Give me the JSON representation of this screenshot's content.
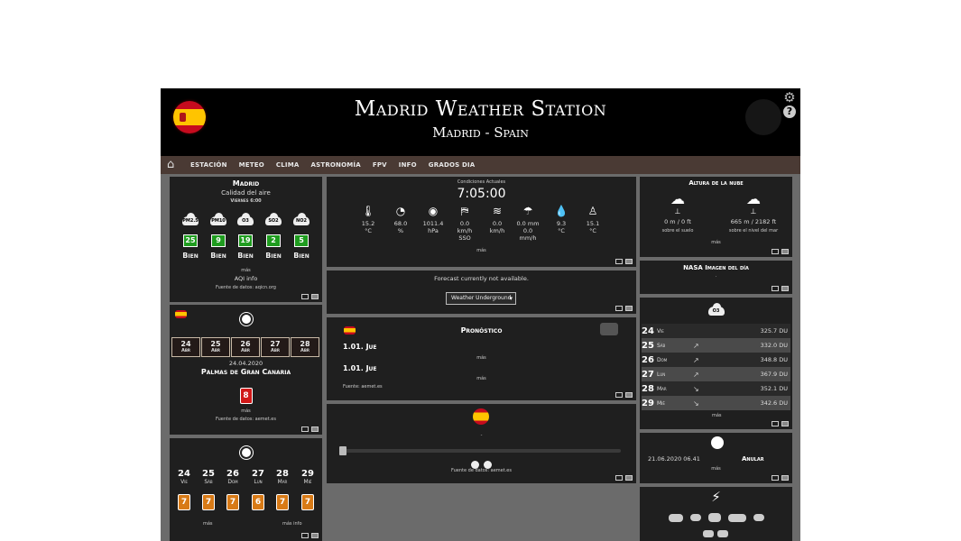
{
  "header": {
    "title": "Madrid Weather Station",
    "subtitle": "Madrid - Spain"
  },
  "icons": {
    "settings": "gear-icon",
    "help": "question-icon",
    "home": "home-icon"
  },
  "nav": [
    "ESTACIÓN",
    "METEO",
    "CLIMA",
    "ASTRONOMÍA",
    "FPV",
    "INFO",
    "GRADOS DIA"
  ],
  "air": {
    "city": "Madrid",
    "title": "Calidad del aire",
    "time": "Viernes 6:00",
    "pollutants": [
      {
        "name": "PM2.5",
        "value": "25",
        "status": "Bien"
      },
      {
        "name": "PM10",
        "value": "9",
        "status": "Bien"
      },
      {
        "name": "O3",
        "value": "19",
        "status": "Bien"
      },
      {
        "name": "SO2",
        "value": "2",
        "status": "Bien"
      },
      {
        "name": "NO2",
        "value": "5",
        "status": "Bien"
      }
    ],
    "more": "más",
    "info": "AQI info",
    "source": "Fuente de datos: aqicn.org"
  },
  "sun_card": {
    "days": [
      {
        "n": "24",
        "m": "Abr"
      },
      {
        "n": "25",
        "m": "Abr"
      },
      {
        "n": "26",
        "m": "Abr"
      },
      {
        "n": "27",
        "m": "Abr"
      },
      {
        "n": "28",
        "m": "Abr"
      }
    ],
    "date": "24.04.2020",
    "place": "Palmas de Gran Canaria",
    "value": "8",
    "more": "más",
    "source": "Fuente de datos: aemet.es"
  },
  "uv_card": {
    "days": [
      {
        "n": "24",
        "d": "Vie",
        "v": "7"
      },
      {
        "n": "25",
        "d": "Sáb",
        "v": "7"
      },
      {
        "n": "26",
        "d": "Dom",
        "v": "7"
      },
      {
        "n": "27",
        "d": "Lun",
        "v": "6"
      },
      {
        "n": "28",
        "d": "Mar",
        "v": "7"
      },
      {
        "n": "29",
        "d": "Mié",
        "v": "7"
      }
    ],
    "more": "más",
    "more_info": "más info"
  },
  "conditions": {
    "title": "Condiciones Actuales",
    "time": "7:05:00",
    "items": [
      {
        "icon": "thermometer-icon",
        "v": "15.2",
        "u": "°C"
      },
      {
        "icon": "humidity-gauge-icon",
        "v": "68.0",
        "u": "%"
      },
      {
        "icon": "pressure-icon",
        "v": "1011.4",
        "u": "hPa"
      },
      {
        "icon": "wind-sock-icon",
        "v": "0.0",
        "u": "km/h"
      },
      {
        "icon": "wind-icon",
        "v": "0.0",
        "u": "km/h"
      },
      {
        "icon": "rain-icon",
        "v": "0.0 mm",
        "u": "0.0 mm/h"
      },
      {
        "icon": "dew-drop-icon",
        "v": "9.3",
        "u": "°C"
      },
      {
        "icon": "feels-like-icon",
        "v": "15.1",
        "u": "°C"
      }
    ],
    "wind_dir": "SSO",
    "more": "más"
  },
  "forecast_unavailable": {
    "message": "Forecast currently not available.",
    "select": "Weather Underground"
  },
  "pronostico": {
    "title": "Pronóstico",
    "rows": [
      {
        "date": "1.01.",
        "day": "Jue"
      },
      {
        "date": "1.01.",
        "day": "Jue"
      }
    ],
    "more": "más",
    "source": "Fuente: aemet.es"
  },
  "radar": {
    "dot": "-",
    "source": "Fuente de datos: aemet.es"
  },
  "cloud_height": {
    "title": "Altura de la nube",
    "ground": {
      "value": "0 m / 0 ft",
      "label": "sobre el suelo"
    },
    "sea": {
      "value": "665 m / 2182 ft",
      "label": "sobre el nivel del mar"
    },
    "more": "más"
  },
  "nasa": {
    "title": "NASA Imagen del día",
    "dot": "."
  },
  "ozone": {
    "badge": "O3",
    "rows": [
      {
        "n": "24",
        "d": "Vie",
        "trend": "",
        "v": "325.7 DU"
      },
      {
        "n": "25",
        "d": "Sáb",
        "trend": "↗",
        "v": "332.0 DU"
      },
      {
        "n": "26",
        "d": "Dom",
        "trend": "↗",
        "v": "348.8 DU"
      },
      {
        "n": "27",
        "d": "Lun",
        "trend": "↗",
        "v": "367.9 DU"
      },
      {
        "n": "28",
        "d": "Mar",
        "trend": "↘",
        "v": "352.1 DU"
      },
      {
        "n": "29",
        "d": "Mié",
        "trend": "↘",
        "v": "342.6 DU"
      }
    ],
    "more": "más"
  },
  "eclipse": {
    "date": "21.06.2020 06.41",
    "type": "Anular",
    "more": "más"
  }
}
